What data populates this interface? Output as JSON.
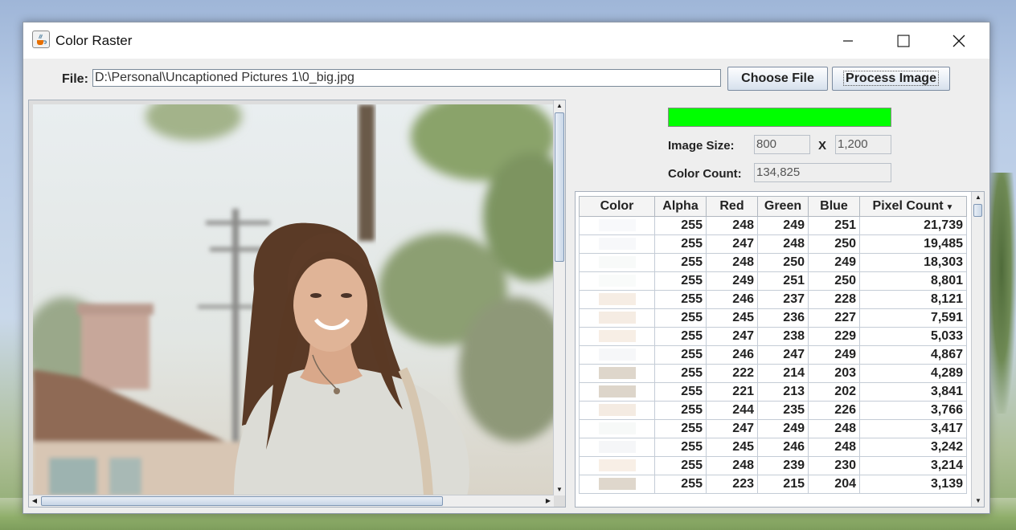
{
  "window": {
    "title": "Color Raster",
    "icon": "java-cup-icon"
  },
  "file": {
    "label": "File:",
    "path": "D:\\Personal\\Uncaptioned Pictures 1\\0_big.jpg"
  },
  "buttons": {
    "choose": "Choose File",
    "process": "Process Image"
  },
  "progress": {
    "fraction": 1.0,
    "color": "#00ff00"
  },
  "image_size": {
    "label": "Image Size:",
    "width": "800",
    "separator": "X",
    "height": "1,200"
  },
  "color_count": {
    "label": "Color Count:",
    "value": "134,825"
  },
  "table": {
    "headers": [
      "Color",
      "Alpha",
      "Red",
      "Green",
      "Blue",
      "Pixel Count"
    ],
    "sorted_column": "Pixel Count",
    "rows": [
      {
        "color": "#f8f9fb",
        "alpha": "255",
        "red": "248",
        "green": "249",
        "blue": "251",
        "count": "21,739"
      },
      {
        "color": "#f7f8fa",
        "alpha": "255",
        "red": "247",
        "green": "248",
        "blue": "250",
        "count": "19,485"
      },
      {
        "color": "#f8faf9",
        "alpha": "255",
        "red": "248",
        "green": "250",
        "blue": "249",
        "count": "18,303"
      },
      {
        "color": "#f9fbfa",
        "alpha": "255",
        "red": "249",
        "green": "251",
        "blue": "250",
        "count": "8,801"
      },
      {
        "color": "#f6ede4",
        "alpha": "255",
        "red": "246",
        "green": "237",
        "blue": "228",
        "count": "8,121"
      },
      {
        "color": "#f5ece3",
        "alpha": "255",
        "red": "245",
        "green": "236",
        "blue": "227",
        "count": "7,591"
      },
      {
        "color": "#f7eee5",
        "alpha": "255",
        "red": "247",
        "green": "238",
        "blue": "229",
        "count": "5,033"
      },
      {
        "color": "#f6f7f9",
        "alpha": "255",
        "red": "246",
        "green": "247",
        "blue": "249",
        "count": "4,867"
      },
      {
        "color": "#ded6cb",
        "alpha": "255",
        "red": "222",
        "green": "214",
        "blue": "203",
        "count": "4,289"
      },
      {
        "color": "#ddd5ca",
        "alpha": "255",
        "red": "221",
        "green": "213",
        "blue": "202",
        "count": "3,841"
      },
      {
        "color": "#f4ebe2",
        "alpha": "255",
        "red": "244",
        "green": "235",
        "blue": "226",
        "count": "3,766"
      },
      {
        "color": "#f7f9f8",
        "alpha": "255",
        "red": "247",
        "green": "249",
        "blue": "248",
        "count": "3,417"
      },
      {
        "color": "#f5f6f8",
        "alpha": "255",
        "red": "245",
        "green": "246",
        "blue": "248",
        "count": "3,242"
      },
      {
        "color": "#f8efe6",
        "alpha": "255",
        "red": "248",
        "green": "239",
        "blue": "230",
        "count": "3,214"
      },
      {
        "color": "#dfd7cc",
        "alpha": "255",
        "red": "223",
        "green": "215",
        "blue": "204",
        "count": "3,139"
      }
    ]
  }
}
